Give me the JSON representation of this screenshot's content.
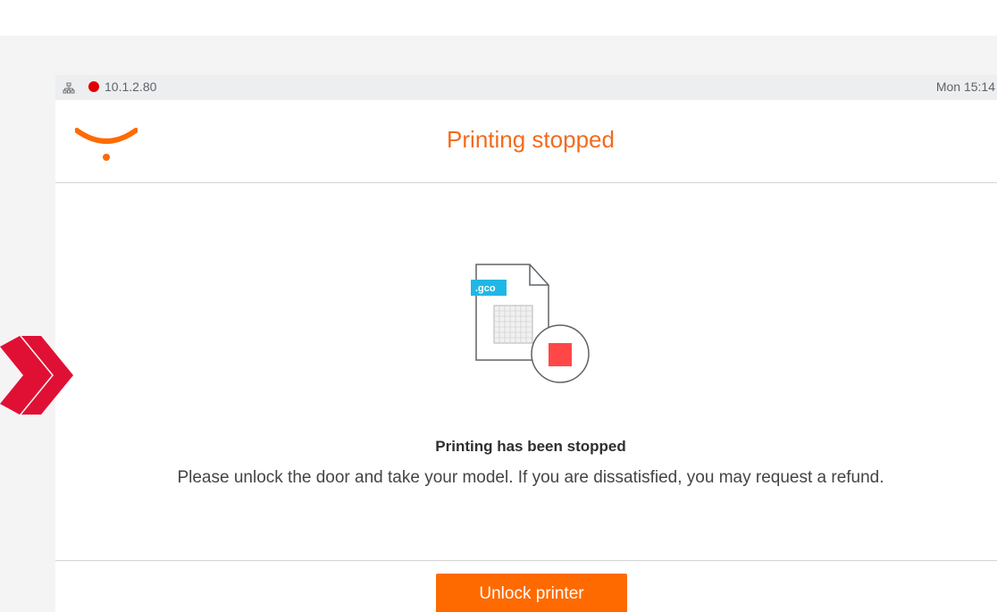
{
  "status_bar": {
    "network_icon": "network-icon",
    "connection_status": "disconnected",
    "status_color": "#e00000",
    "ip_address": "10.1.2.80",
    "clock": "Mon 15:14"
  },
  "header": {
    "logo_icon": "smile-logo",
    "title": "Printing stopped"
  },
  "content": {
    "file_badge": ".gco",
    "illustration_icon": "stopped-file-icon",
    "message_title": "Printing has been stopped",
    "message_body": "Please unlock the door and take your model. If you are dissatisfied, you may request a refund."
  },
  "footer": {
    "primary_button": "Unlock printer"
  },
  "overlay": {
    "indicator_icon": "double-chevron-right-icon"
  },
  "colors": {
    "accent": "#ff6a00",
    "title": "#f26b1d",
    "stop_red": "#ff4747",
    "badge_blue": "#21b7e5",
    "overlay_red": "#e01035"
  }
}
